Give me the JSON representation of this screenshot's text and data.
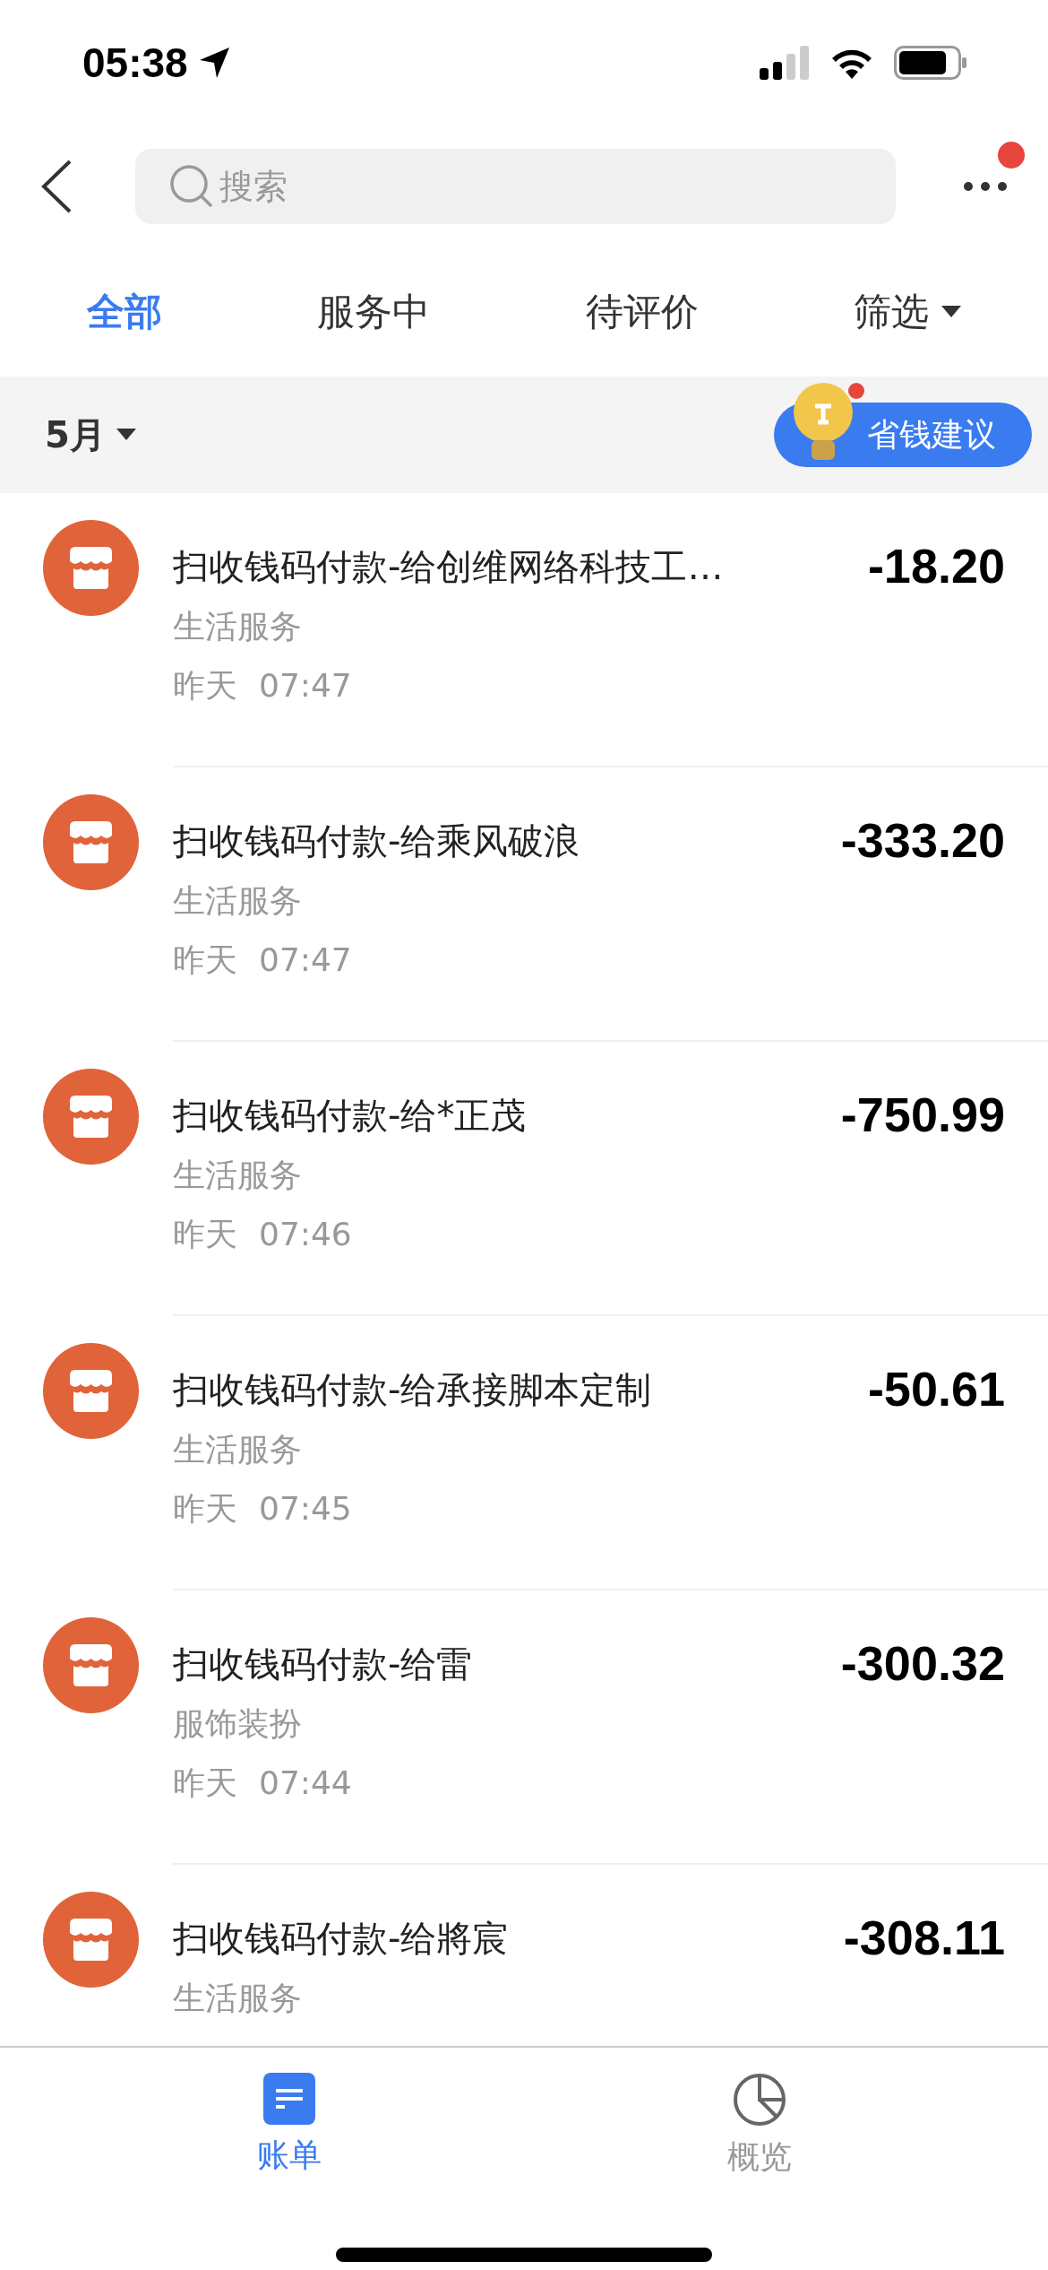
{
  "status_bar": {
    "time": "05:38"
  },
  "header": {
    "search": {
      "placeholder": "搜索"
    },
    "more_badge": true
  },
  "tabs": [
    {
      "label": "全部",
      "selected": true,
      "kind": "tab"
    },
    {
      "label": "服务中",
      "selected": false,
      "kind": "tab"
    },
    {
      "label": "待评价",
      "selected": false,
      "kind": "tab"
    },
    {
      "label": "筛选",
      "selected": false,
      "kind": "dropdown"
    }
  ],
  "month_bar": {
    "month": "5月",
    "tip_button": {
      "label": "省钱建议",
      "badge": true
    }
  },
  "transactions": [
    {
      "title": "扫收钱码付款-给创维网络科技工…",
      "category": "生活服务",
      "date": "昨天",
      "time": "07:47",
      "amount": "-18.20"
    },
    {
      "title": "扫收钱码付款-给乘风破浪",
      "category": "生活服务",
      "date": "昨天",
      "time": "07:47",
      "amount": "-333.20"
    },
    {
      "title": "扫收钱码付款-给*正茂",
      "category": "生活服务",
      "date": "昨天",
      "time": "07:46",
      "amount": "-750.99"
    },
    {
      "title": "扫收钱码付款-给承接脚本定制",
      "category": "生活服务",
      "date": "昨天",
      "time": "07:45",
      "amount": "-50.61"
    },
    {
      "title": "扫收钱码付款-给雷",
      "category": "服饰装扮",
      "date": "昨天",
      "time": "07:44",
      "amount": "-300.32"
    },
    {
      "title": "扫收钱码付款-给將宸",
      "category": "生活服务",
      "amount": "-308.11"
    }
  ],
  "bottom_tabs": [
    {
      "label": "账单",
      "selected": true,
      "kind": "bill"
    },
    {
      "label": "概览",
      "selected": false,
      "kind": "overview"
    }
  ]
}
